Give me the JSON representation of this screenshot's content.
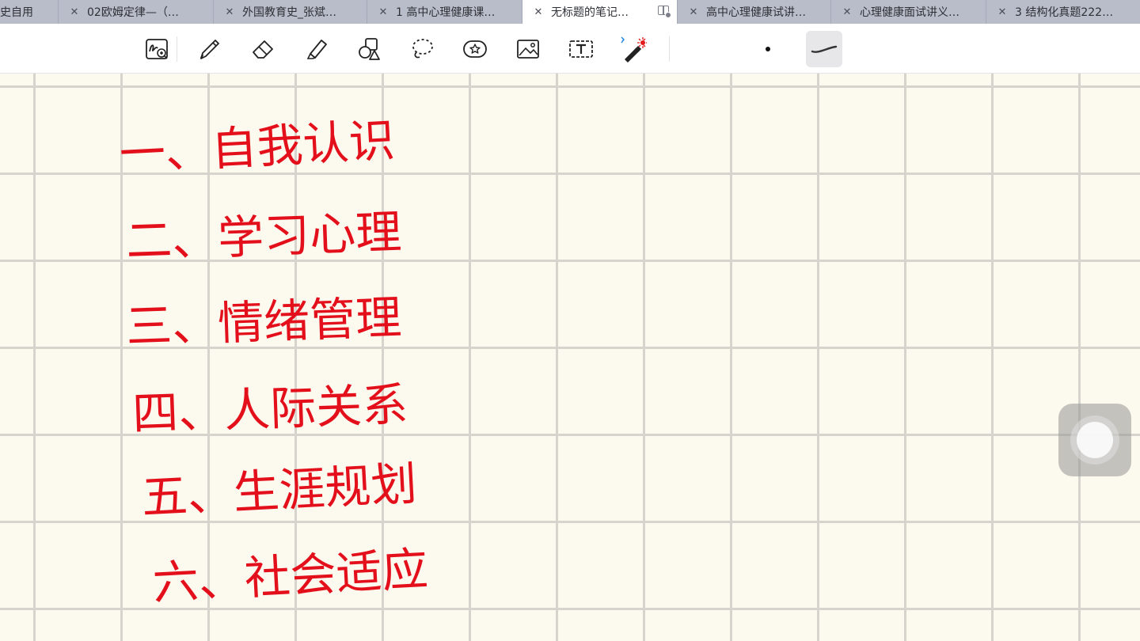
{
  "tabs": [
    {
      "label": "史自用",
      "active": false,
      "closable": false
    },
    {
      "label": "02欧姆定律—（…",
      "active": false,
      "closable": true
    },
    {
      "label": "外国教育史_张斌…",
      "active": false,
      "closable": true
    },
    {
      "label": "1 高中心理健康课…",
      "active": false,
      "closable": true
    },
    {
      "label": "无标题的笔记…",
      "active": true,
      "closable": true
    },
    {
      "label": "高中心理健康试讲…",
      "active": false,
      "closable": true
    },
    {
      "label": "心理健康面试讲义…",
      "active": false,
      "closable": true
    },
    {
      "label": "3 结构化真题222…",
      "active": false,
      "closable": true
    }
  ],
  "toolbar": {
    "tools": [
      "zoom-window-icon",
      "pen-icon",
      "eraser-icon",
      "highlighter-icon",
      "shapes-icon",
      "lasso-icon",
      "sticker-icon",
      "image-icon",
      "text-box-icon",
      "laser-pointer-icon"
    ]
  },
  "note": {
    "ink_color": "#e3101c",
    "lines": [
      "一、自我认识",
      "二、学习心理",
      "三、情绪管理",
      "四、人际关系",
      "五、生涯规划",
      "六、社会适应"
    ]
  }
}
